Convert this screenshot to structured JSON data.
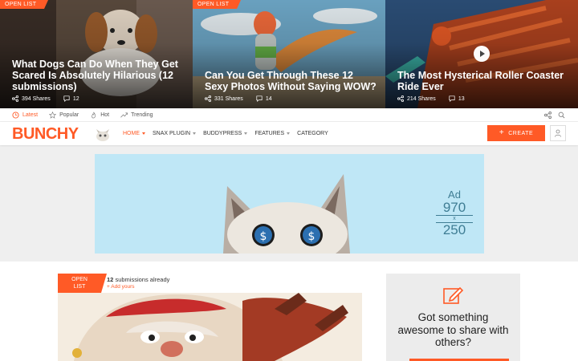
{
  "hero": {
    "cards": [
      {
        "badge": "OPEN LIST",
        "title": "What Dogs Can Do When They Get Scared Is Absolutely Hilarious (12 submissions)",
        "shares": "394 Shares",
        "comments": "12"
      },
      {
        "badge": "OPEN LIST",
        "title": "Can You Get Through These 12 Sexy Photos Without Saying WOW?",
        "shares": "331 Shares",
        "comments": "14"
      },
      {
        "badge": "",
        "title": "The Most Hysterical Roller Coaster Ride Ever",
        "shares": "214 Shares",
        "comments": "13"
      }
    ]
  },
  "subnav": {
    "latest": "Latest",
    "popular": "Popular",
    "hot": "Hot",
    "trending": "Trending"
  },
  "header": {
    "logo": "BUNCHY",
    "menu": [
      "HOME",
      "SNAX PLUGIN",
      "BUDDYPRESS",
      "FEATURES",
      "CATEGORY"
    ],
    "create_label": "CREATE"
  },
  "ad": {
    "line1": "Ad",
    "line2": "970",
    "line3": "x",
    "line4": "250"
  },
  "post": {
    "badge_line1": "OPEN",
    "badge_line2": "LIST",
    "count": "12",
    "count_text": "submissions already",
    "add_yours": "+ Add yours"
  },
  "sidebar": {
    "title": "Got something awesome to share with others?"
  },
  "colors": {
    "accent": "#ff5a26",
    "ad_bg": "#bfe7f6"
  }
}
